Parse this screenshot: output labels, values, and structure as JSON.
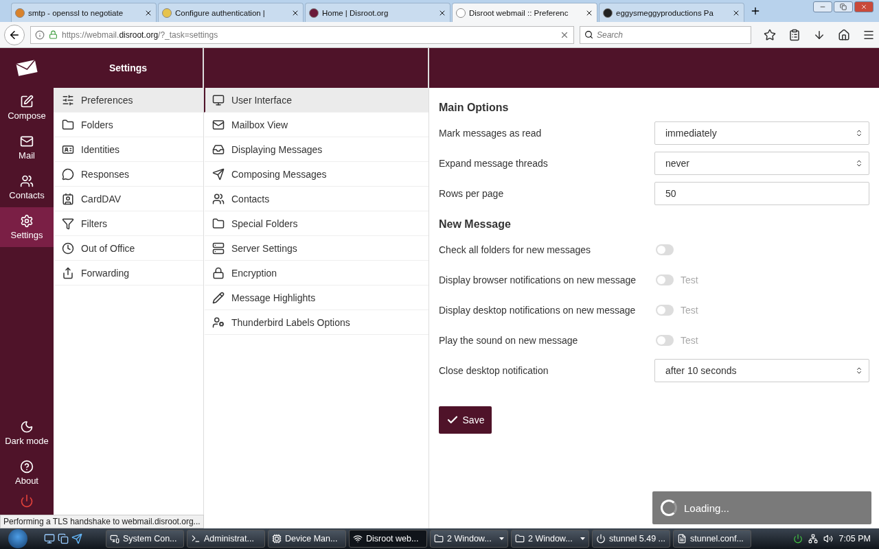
{
  "browser": {
    "tabs": [
      {
        "title": "smtp - openssl to negotiate",
        "selected": false
      },
      {
        "title": "Configure authentication |",
        "selected": false
      },
      {
        "title": "Home | Disroot.org",
        "selected": false
      },
      {
        "title": "Disroot webmail :: Preferenc",
        "selected": true
      },
      {
        "title": "eggysmeggyproductions Pa",
        "selected": false
      }
    ],
    "url": "https://webmail.**disroot.org**/?_task=settings",
    "search": {
      "placeholder": "Search"
    }
  },
  "nav": {
    "items": [
      {
        "label": "Compose",
        "selected": false
      },
      {
        "label": "Mail",
        "selected": false
      },
      {
        "label": "Contacts",
        "selected": false
      },
      {
        "label": "Settings",
        "selected": true
      }
    ],
    "bottom": [
      {
        "label": "Dark mode"
      },
      {
        "label": "About"
      }
    ]
  },
  "settings": {
    "title": "Settings",
    "items": [
      {
        "label": "Preferences",
        "selected": true
      },
      {
        "label": "Folders",
        "selected": false
      },
      {
        "label": "Identities",
        "selected": false
      },
      {
        "label": "Responses",
        "selected": false
      },
      {
        "label": "CardDAV",
        "selected": false
      },
      {
        "label": "Filters",
        "selected": false
      },
      {
        "label": "Out of Office",
        "selected": false
      },
      {
        "label": "Forwarding",
        "selected": false
      }
    ]
  },
  "sections": [
    {
      "label": "User Interface",
      "selected": true
    },
    {
      "label": "Mailbox View",
      "selected": false
    },
    {
      "label": "Displaying Messages",
      "selected": false
    },
    {
      "label": "Composing Messages",
      "selected": false
    },
    {
      "label": "Contacts",
      "selected": false
    },
    {
      "label": "Special Folders",
      "selected": false
    },
    {
      "label": "Server Settings",
      "selected": false
    },
    {
      "label": "Encryption",
      "selected": false
    },
    {
      "label": "Message Highlights",
      "selected": false
    },
    {
      "label": "Thunderbird Labels Options",
      "selected": false
    }
  ],
  "form": {
    "groups": [
      {
        "title": "Main Options",
        "rows": [
          {
            "kind": "select",
            "label": "Mark messages as read",
            "value": "immediately"
          },
          {
            "kind": "select",
            "label": "Expand message threads",
            "value": "never"
          },
          {
            "kind": "input",
            "label": "Rows per page",
            "value": "50"
          }
        ]
      },
      {
        "title": "New Message",
        "rows": [
          {
            "kind": "toggle",
            "label": "Check all folders for new messages",
            "on": false
          },
          {
            "kind": "toggle",
            "label": "Display browser notifications on new message",
            "on": false,
            "test": "Test"
          },
          {
            "kind": "toggle",
            "label": "Display desktop notifications on new message",
            "on": false,
            "test": "Test"
          },
          {
            "kind": "toggle",
            "label": "Play the sound on new message",
            "on": false,
            "test": "Test"
          },
          {
            "kind": "select",
            "label": "Close desktop notification",
            "value": "after 10 seconds"
          }
        ]
      }
    ],
    "save": "Save"
  },
  "loading": "Loading...",
  "status": "Performing a TLS handshake to webmail.disroot.org...",
  "taskbar": {
    "tasks": [
      {
        "label": "System Con...",
        "selected": false,
        "dropdown": false
      },
      {
        "label": "Administrat...",
        "selected": false,
        "dropdown": false
      },
      {
        "label": "Device Man...",
        "selected": false,
        "dropdown": false
      },
      {
        "label": "Disroot web...",
        "selected": true,
        "dropdown": false
      },
      {
        "label": "2 Window...",
        "selected": false,
        "dropdown": true
      },
      {
        "label": "2 Window...",
        "selected": false,
        "dropdown": true
      },
      {
        "label": "stunnel 5.49 ...",
        "selected": false,
        "dropdown": false
      },
      {
        "label": "stunnel.conf...",
        "selected": false,
        "dropdown": false
      }
    ],
    "clock": "7:05 PM"
  }
}
